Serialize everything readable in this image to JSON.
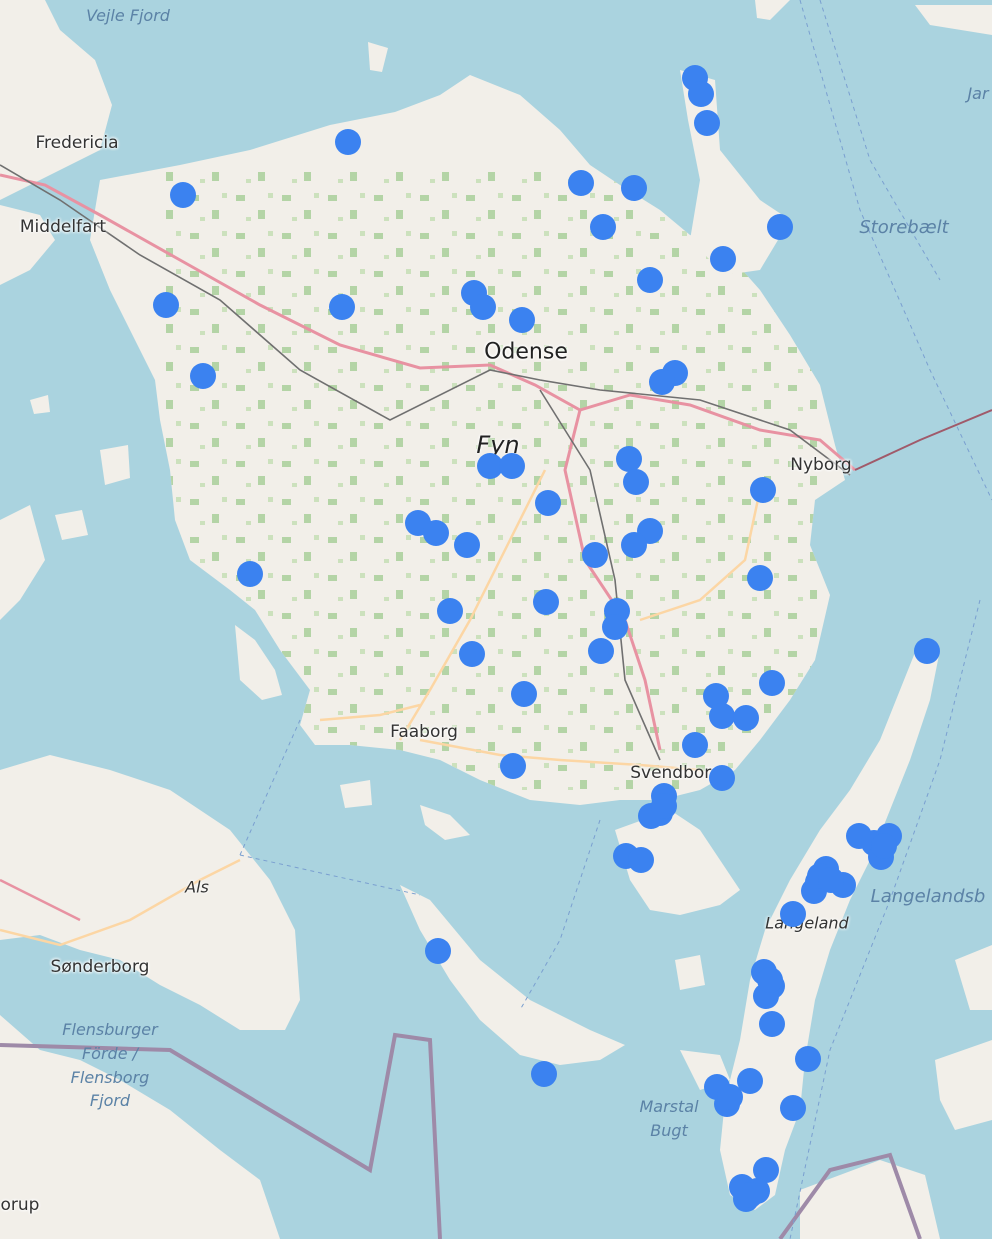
{
  "labels": {
    "fredericia": "Fredericia",
    "middelfart": "Middelfart",
    "odense": "Odense",
    "fyn": "Fyn",
    "nyborg": "Nyborg",
    "faaborg": "Faaborg",
    "svendborg": "Svendborg",
    "als": "Als",
    "sonderborg": "Sønderborg",
    "langeland": "Langeland",
    "orup": "orup",
    "vejle_fjord": "Vejle Fjord",
    "storebaelt": "Storebælt",
    "langelandsbaelt": "Langelandsb",
    "jar": "Jar",
    "flensburger_line1": "Flensburger",
    "flensburger_line2": "Förde /",
    "flensburger_line3": "Flensborg",
    "flensburger_line4": "Fjord",
    "marstal_line1": "Marstal",
    "marstal_line2": "Bugt"
  },
  "colors": {
    "water": "#aad3df",
    "land": "#f2efe9",
    "forest": "#add19e",
    "motorway": "#e892a2",
    "primary_road": "#fcd6a4",
    "railway": "#707070",
    "border": "#9e8aa8",
    "marker": "#3b82f0"
  },
  "markers_count": 84
}
